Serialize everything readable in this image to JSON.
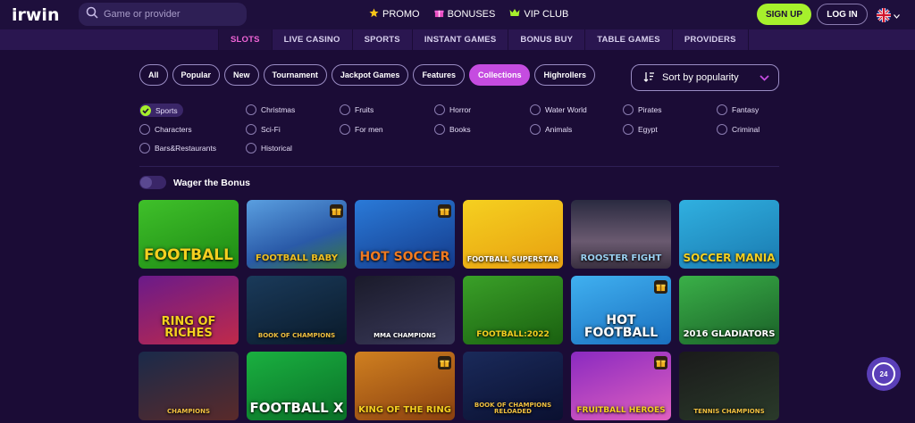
{
  "brand": {
    "logo": "irwin"
  },
  "search": {
    "placeholder": "Game or provider"
  },
  "topnav": [
    {
      "label": "PROMO",
      "icon": "star-icon"
    },
    {
      "label": "BONUSES",
      "icon": "gift-icon"
    },
    {
      "label": "VIP CLUB",
      "icon": "crown-icon"
    }
  ],
  "auth": {
    "signup": "SIGN UP",
    "login": "LOG IN"
  },
  "language": {
    "icon": "uk-flag-icon"
  },
  "categories": [
    "SLOTS",
    "LIVE CASINO",
    "SPORTS",
    "INSTANT GAMES",
    "BONUS BUY",
    "TABLE GAMES",
    "PROVIDERS"
  ],
  "active_category": "SLOTS",
  "pills": [
    "All",
    "Popular",
    "New",
    "Tournament",
    "Jackpot Games",
    "Features",
    "Collections",
    "Highrollers"
  ],
  "active_pill": "Collections",
  "sort": {
    "label": "Sort by popularity"
  },
  "collections": [
    [
      "Sports",
      "Christmas",
      "Fruits",
      "Horror",
      "Water World",
      "Pirates",
      "Fantasy"
    ],
    [
      "Characters",
      "Sci-Fi",
      "For men",
      "Books",
      "Animals",
      "Egypt",
      "Criminal"
    ],
    [
      "Bars&Restaurants",
      "Historical"
    ]
  ],
  "checked_collection": "Sports",
  "wager": {
    "label": "Wager the Bonus",
    "enabled": false
  },
  "games": [
    {
      "title": "FOOTBALL",
      "gift": false
    },
    {
      "title": "FOOTBALL BABY",
      "gift": true
    },
    {
      "title": "HOT SOCCER",
      "gift": true
    },
    {
      "title": "FOOTBALL SUPERSTAR",
      "gift": false
    },
    {
      "title": "ROOSTER FIGHT",
      "gift": false
    },
    {
      "title": "SOCCER MANIA",
      "gift": false
    },
    {
      "title": "RING OF RICHES",
      "gift": false
    },
    {
      "title": "BOOK OF CHAMPIONS",
      "gift": false
    },
    {
      "title": "MMA CHAMPIONS",
      "gift": false
    },
    {
      "title": "FOOTBALL:2022",
      "gift": false
    },
    {
      "title": "HOT FOOTBALL",
      "gift": true
    },
    {
      "title": "2016 GLADIATORS",
      "gift": false
    },
    {
      "title": "CHAMPIONS",
      "gift": false
    },
    {
      "title": "FOOTBALL X",
      "gift": false
    },
    {
      "title": "KING OF THE RING",
      "gift": true
    },
    {
      "title": "BOOK OF CHAMPIONS RELOADED",
      "gift": false
    },
    {
      "title": "FRUITBALL HEROES",
      "gift": true
    },
    {
      "title": "TENNIS CHAMPIONS",
      "gift": false
    }
  ],
  "support": {
    "label": "24",
    "icon": "support-chat-icon"
  }
}
